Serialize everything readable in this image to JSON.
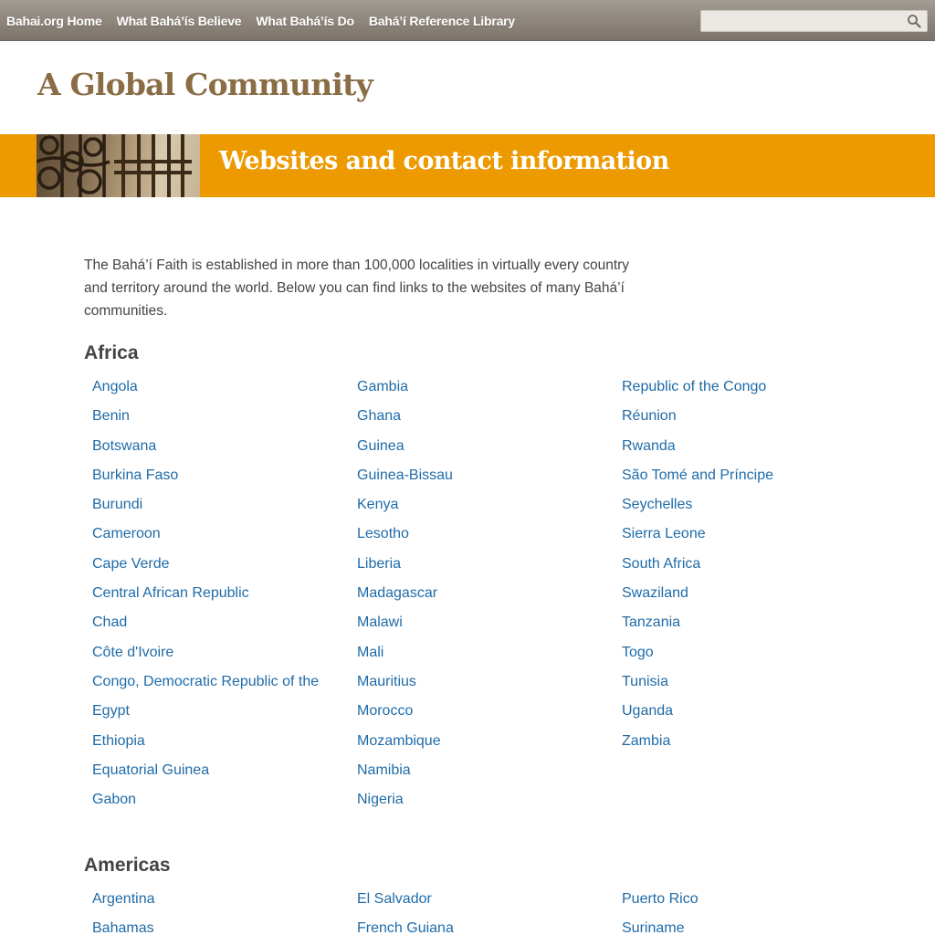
{
  "nav": {
    "items": [
      "Bahai.org Home",
      "What Bahá’ís Believe",
      "What Bahá’ís Do",
      "Bahá’í Reference Library"
    ],
    "search_placeholder": ""
  },
  "site_title": "A Global Community",
  "banner": {
    "title": "Websites and contact information"
  },
  "intro": "The Bahá’í Faith is established in more than 100,000 localities in virtually every country and territory around the world. Below you can find links to the websites of many Bahá’í communities.",
  "regions": [
    {
      "name": "Africa",
      "columns": [
        [
          "Angola",
          "Benin",
          "Botswana",
          "Burkina Faso",
          "Burundi",
          "Cameroon",
          "Cape Verde",
          "Central African Republic",
          "Chad",
          "Côte d'Ivoire",
          "Congo, Democratic Republic of the",
          "Egypt",
          "Ethiopia",
          "Equatorial Guinea",
          "Gabon"
        ],
        [
          "Gambia",
          "Ghana",
          "Guinea",
          "Guinea-Bissau",
          "Kenya",
          "Lesotho",
          "Liberia",
          "Madagascar",
          "Malawi",
          "Mali",
          "Mauritius",
          "Morocco",
          "Mozambique",
          "Namibia",
          "Nigeria"
        ],
        [
          "Republic of the Congo",
          "Réunion",
          "Rwanda",
          "São Tomé and Príncipe",
          "Seychelles",
          "Sierra Leone",
          "South Africa",
          "Swaziland",
          "Tanzania",
          "Togo",
          "Tunisia",
          "Uganda",
          "Zambia"
        ]
      ]
    },
    {
      "name": "Americas",
      "columns": [
        [
          "Argentina",
          "Bahamas"
        ],
        [
          "El Salvador",
          "French Guiana"
        ],
        [
          "Puerto Rico",
          "Suriname"
        ]
      ]
    }
  ],
  "colors": {
    "nav_bar": "#8d857c",
    "banner": "#ec9a00",
    "title": "#8a6d45",
    "link": "#1f6ba8"
  }
}
